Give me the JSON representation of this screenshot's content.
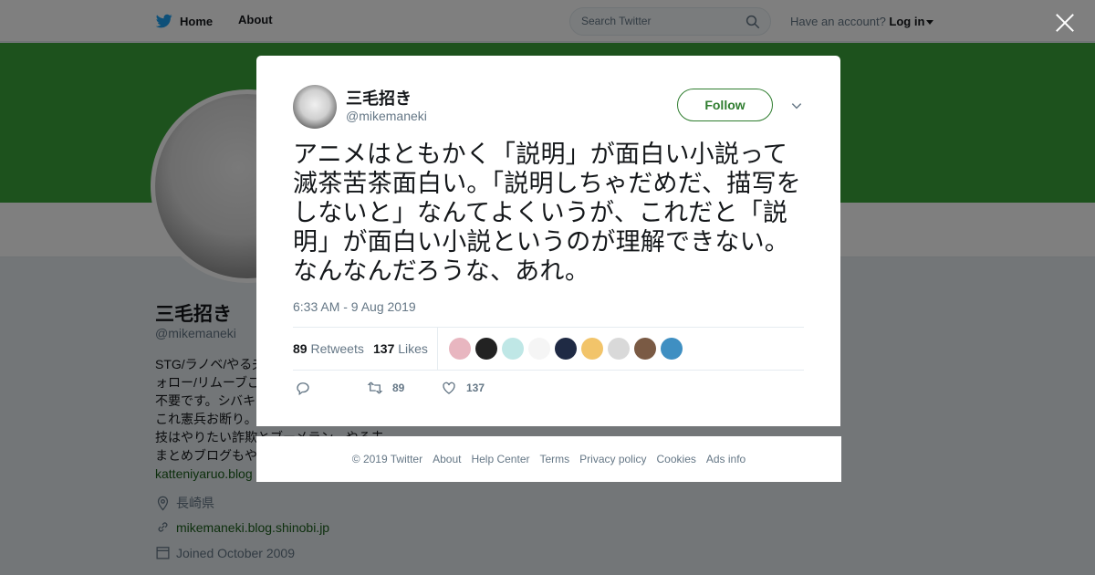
{
  "nav": {
    "home_label": "Home",
    "about_label": "About",
    "search_placeholder": "Search Twitter",
    "account_prompt": "Have an account?",
    "login_label": "Log in"
  },
  "profile": {
    "name": "三毛招き",
    "handle": "@mikemaneki",
    "bio_lines": [
      "STG/ラノベ/やる夫",
      "ォロー/リムーブご",
      "不要です。シバキ",
      "これ憲兵お断り。",
      "技はやりたい詐欺とブーメラン。やる夫",
      "まとめブログもや",
      "katteniyaruo.blog"
    ],
    "location": "長崎県",
    "website": "mikemaneki.blog.shinobi.jp",
    "joined": "Joined October 2009"
  },
  "tweet": {
    "author_name": "三毛招き",
    "author_handle": "@mikemaneki",
    "follow_label": "Follow",
    "text": "アニメはともかく「説明」が面白い小説って滅茶苦茶面白い。「説明しちゃだめだ、描写をしないと」なんてよくいうが、これだと「説明」が面白い小説というのが理解できない。なんなんだろうな、あれ。",
    "timestamp": "6:33 AM - 9 Aug 2019",
    "retweets_count": "89",
    "retweets_label": "Retweets",
    "likes_count": "137",
    "likes_label": "Likes",
    "reply_count": "",
    "retweet_action_count": "89",
    "like_action_count": "137"
  },
  "liker_colors": [
    "#e8b6c0",
    "#222222",
    "#bfe7e6",
    "#f5f5f5",
    "#1f2a44",
    "#f2c46a",
    "#d9d9d9",
    "#7a5a44",
    "#3f8fc2"
  ],
  "footer": {
    "links": [
      "© 2019 Twitter",
      "About",
      "Help Center",
      "Terms",
      "Privacy policy",
      "Cookies",
      "Ads info"
    ]
  },
  "colors": {
    "banner": "#3aa43a",
    "accent": "#2f7d2f",
    "twitter_blue": "#1da1f2"
  }
}
